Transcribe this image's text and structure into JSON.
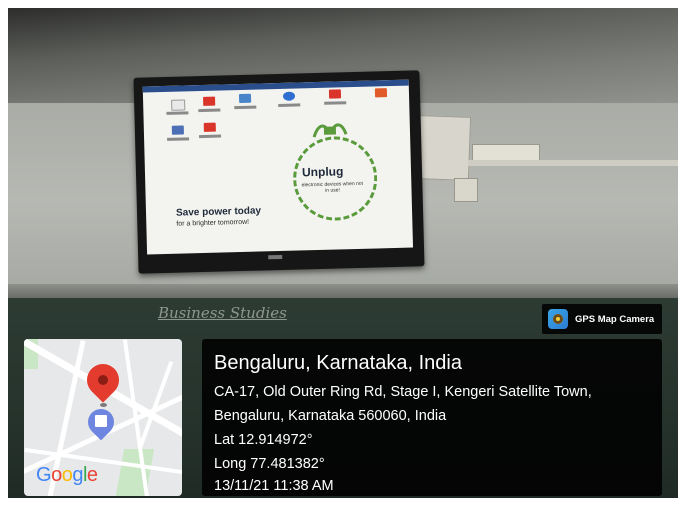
{
  "tv_screen": {
    "save_line": "Save power today",
    "save_sub": "for a brighter tomorrow!",
    "unplug_title": "Unplug",
    "unplug_sub": "electronic devices when not in use!"
  },
  "board": {
    "chalk_text": "Business Studies"
  },
  "gps_badge": {
    "app_name": "GPS Map Camera",
    "icon": "camera-lens-icon"
  },
  "location": {
    "title": "Bengaluru, Karnataka, India",
    "address_line1": "CA-17, Old Outer Ring Rd, Stage I, Kengeri Satellite Town,",
    "address_line2": "Bengaluru, Karnataka 560060, India",
    "latitude": "Lat 12.914972°",
    "longitude": "Long 77.481382°",
    "timestamp": "13/11/21 11:38 AM"
  },
  "map": {
    "logo_text": "Google",
    "pin_icon": "map-pin-icon"
  }
}
